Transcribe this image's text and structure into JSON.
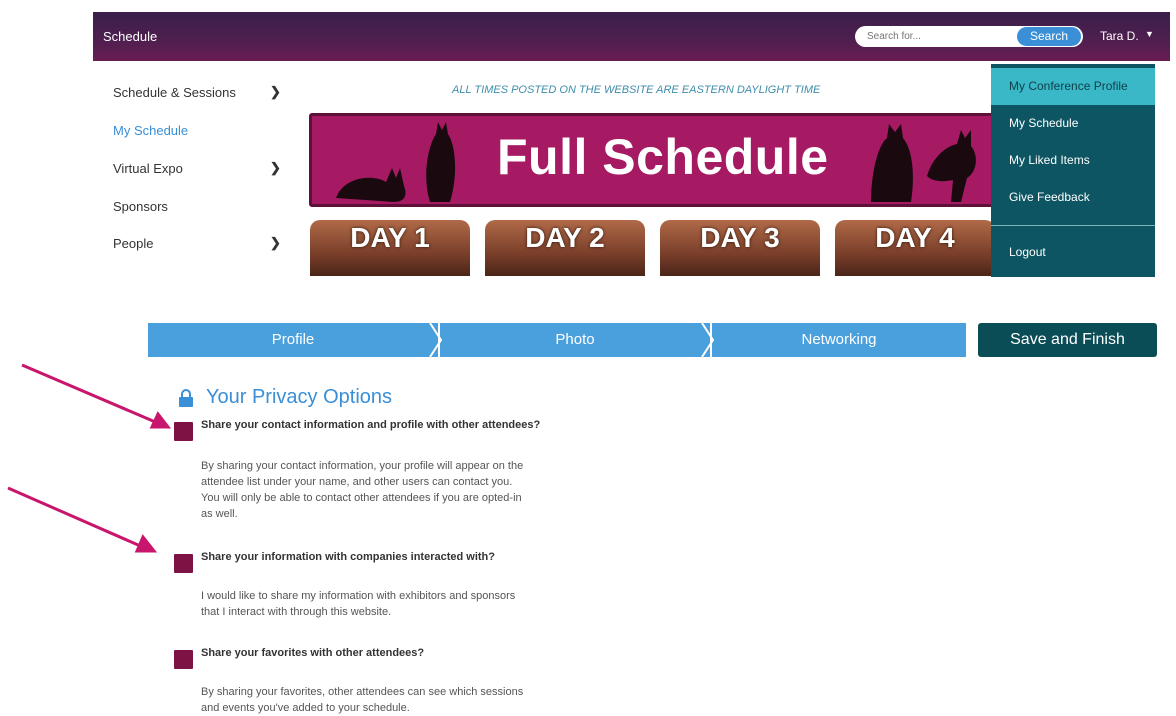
{
  "topbar": {
    "title": "Schedule",
    "search": {
      "placeholder": "Search for...",
      "button_label": "Search"
    },
    "user": {
      "name": "Tara D."
    }
  },
  "sidebar": {
    "items": [
      {
        "label": "Schedule & Sessions"
      },
      {
        "label": "My Schedule"
      },
      {
        "label": "Virtual Expo"
      },
      {
        "label": "Sponsors"
      },
      {
        "label": "People"
      }
    ]
  },
  "main": {
    "notice": "ALL TIMES POSTED ON THE WEBSITE ARE EASTERN DAYLIGHT TIME",
    "banner_title": "Full Schedule",
    "days": [
      "DAY 1",
      "DAY 2",
      "DAY 3",
      "DAY 4"
    ]
  },
  "user_menu": {
    "items": [
      {
        "label": "My Conference Profile"
      },
      {
        "label": "My Schedule"
      },
      {
        "label": "My Liked Items"
      },
      {
        "label": "Give Feedback"
      },
      {
        "label": "Logout"
      }
    ]
  },
  "steps": {
    "items": [
      "Profile",
      "Photo",
      "Networking"
    ],
    "save_label": "Save and Finish"
  },
  "privacy": {
    "title": "Your Privacy Options",
    "options": [
      {
        "question": "Share your contact information and profile with other attendees?",
        "lines": [
          "By sharing your contact information, your profile will appear on the",
          "attendee list under your name, and other users can contact you.",
          "You will only be able to contact other attendees if you are opted-in",
          "as well."
        ]
      },
      {
        "question": "Share your information with companies interacted with?",
        "lines": [
          "I would like to share my information with exhibitors and sponsors",
          "that I interact with through this website."
        ]
      },
      {
        "question": "Share your favorites with other attendees?",
        "lines": [
          "By sharing your favorites, other attendees can see which sessions",
          "and events you've added to your schedule."
        ]
      }
    ]
  },
  "colors": {
    "accent_blue": "#4aa0dc",
    "dark_teal": "#0a4d57",
    "checkbox": "#7d1345",
    "banner": "#a61a63",
    "arrow": "#c8166c"
  }
}
